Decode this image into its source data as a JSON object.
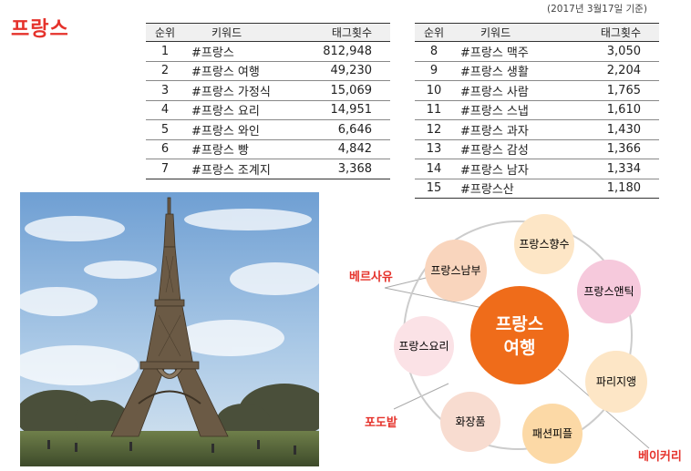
{
  "title": "프랑스",
  "accent_color": "#e5322b",
  "date_note": "(2017년 3월17일 기준)",
  "table_headers": {
    "rank": "순위",
    "keyword": "키워드",
    "count": "태그횟수"
  },
  "table_left": [
    {
      "rank": "1",
      "keyword": "#프랑스",
      "count": "812,948"
    },
    {
      "rank": "2",
      "keyword": "#프랑스 여행",
      "count": "49,230"
    },
    {
      "rank": "3",
      "keyword": "#프랑스 가정식",
      "count": "15,069"
    },
    {
      "rank": "4",
      "keyword": "#프랑스 요리",
      "count": "14,951"
    },
    {
      "rank": "5",
      "keyword": "#프랑스 와인",
      "count": "6,646"
    },
    {
      "rank": "6",
      "keyword": "#프랑스 빵",
      "count": "4,842"
    },
    {
      "rank": "7",
      "keyword": "#프랑스 조계지",
      "count": "3,368"
    }
  ],
  "table_right": [
    {
      "rank": "8",
      "keyword": "#프랑스 맥주",
      "count": "3,050"
    },
    {
      "rank": "9",
      "keyword": "#프랑스 생활",
      "count": "2,204"
    },
    {
      "rank": "10",
      "keyword": "#프랑스 사람",
      "count": "1,765"
    },
    {
      "rank": "11",
      "keyword": "#프랑스 스냅",
      "count": "1,610"
    },
    {
      "rank": "12",
      "keyword": "#프랑스 과자",
      "count": "1,430"
    },
    {
      "rank": "13",
      "keyword": "#프랑스 감성",
      "count": "1,366"
    },
    {
      "rank": "14",
      "keyword": "#프랑스 남자",
      "count": "1,334"
    },
    {
      "rank": "15",
      "keyword": "#프랑스산",
      "count": "1,180"
    }
  ],
  "diagram": {
    "center": [
      "프랑스",
      "여행"
    ],
    "nodes": {
      "perfume": "프랑스향수",
      "south": "프랑스남부",
      "antique": "프랑스앤틱",
      "cooking": "프랑스요리",
      "paris": "파리지앵",
      "cosmetics": "화장품",
      "fashion": "패션피플"
    },
    "outer_labels": {
      "versailles": "베르사유",
      "vineyard": "포도밭",
      "bakery": "베이커리"
    }
  },
  "photo_subject": "eiffel-tower"
}
